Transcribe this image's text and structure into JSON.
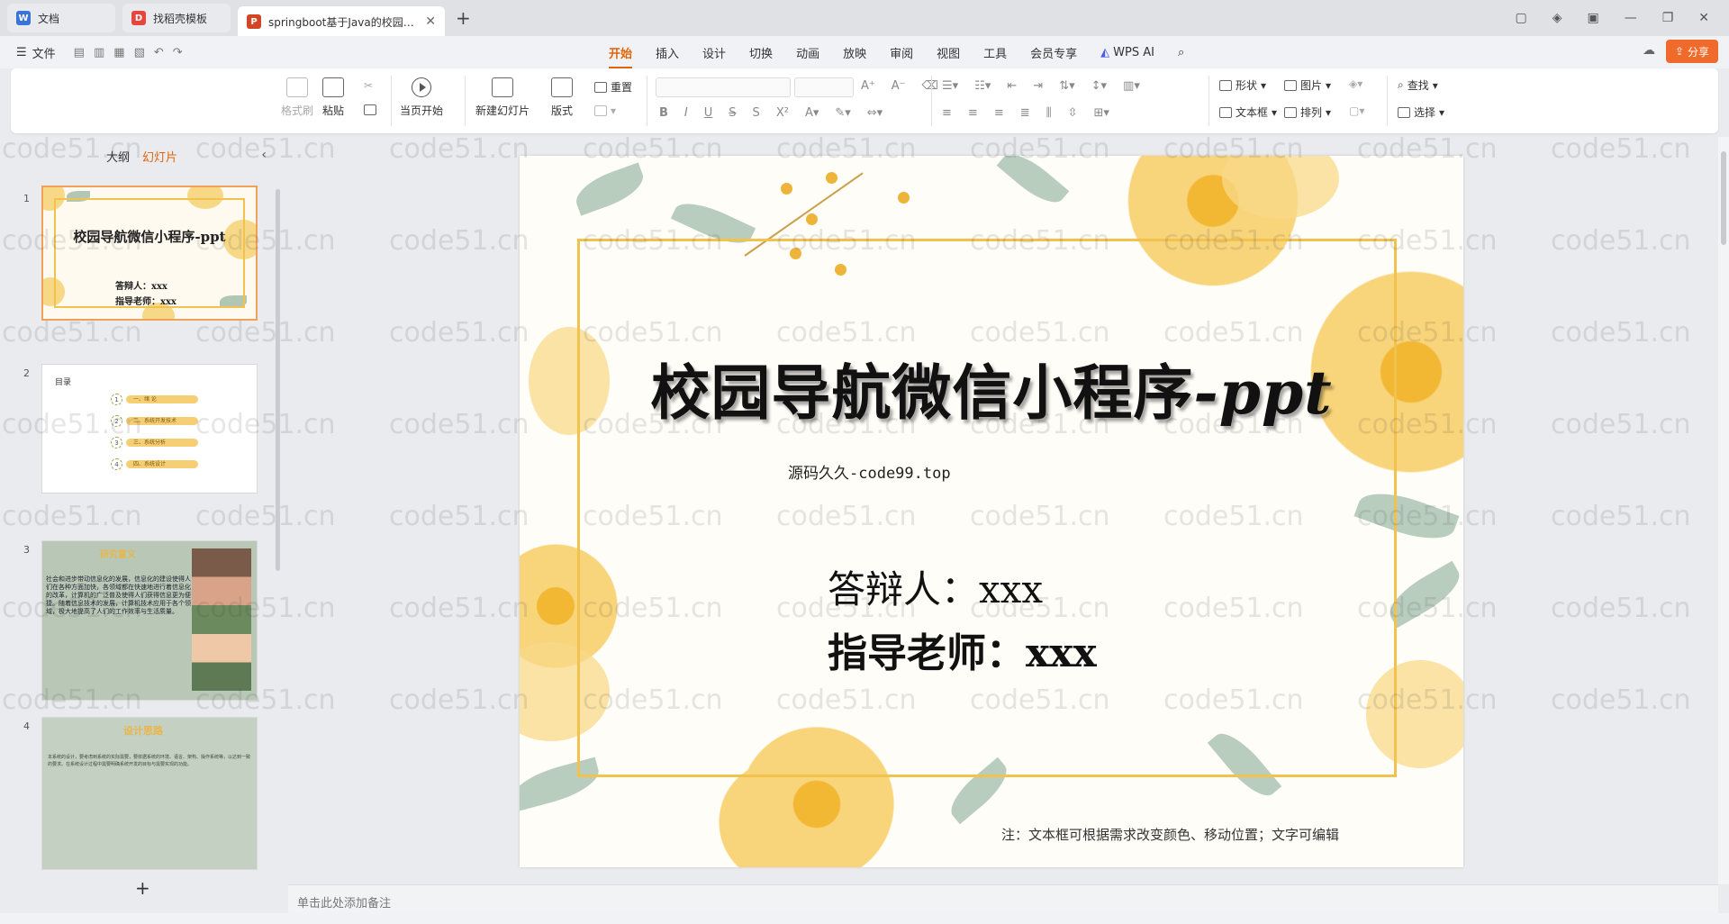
{
  "tabs": [
    {
      "label": "文档",
      "icon": "doc-icon",
      "color": "#3a74d8"
    },
    {
      "label": "找稻壳模板",
      "icon": "docer-icon",
      "color": "#e8453c"
    },
    {
      "label": "springboot基于Java的校园导航",
      "icon": "ppt-icon",
      "color": "#d24625"
    }
  ],
  "menu": {
    "file": "文件",
    "tabs": [
      "开始",
      "插入",
      "设计",
      "切换",
      "动画",
      "放映",
      "审阅",
      "视图",
      "工具",
      "会员专享"
    ],
    "active_tab": "开始",
    "wps_ai": "WPS AI",
    "share": "分享"
  },
  "ribbon": {
    "format_painter": "格式刷",
    "paste": "粘贴",
    "from_start": "当页开始",
    "new_slide": "新建幻灯片",
    "layout": "版式",
    "reset": "重置",
    "shapes": "形状",
    "picture": "图片",
    "textbox": "文本框",
    "arrange": "排列",
    "find": "查找",
    "select": "选择"
  },
  "panel": {
    "tab_outline": "大纲",
    "tab_slides": "幻灯片",
    "slides": [
      {
        "num": "1",
        "title": "校园导航微信小程序-ppt",
        "lines": [
          "答辩人：xxx",
          "指导老师：xxx"
        ]
      },
      {
        "num": "2",
        "label": "目录",
        "items": [
          "一、绪 论",
          "二、系统开发技术",
          "三、系统分析",
          "四、系统设计"
        ]
      },
      {
        "num": "3",
        "header": "研究意义",
        "body": "社会和进步带动信息化的发展，信息化的建设使得人们在各种方面加快，各领域都在快速地进行着信息化的改革，计算机的广泛普及使得人们获得信息更为便捷。随着信息技术的发展，计算机技术应用于各个领域，极大地提高了人们的工作效率与生活质量。"
      },
      {
        "num": "4",
        "header": "设计思路",
        "body": "本系统的设计，要考虑到系统的实际需要，要依据系统的环境、语言、架构、操作系统等，以达到一致的要求。在系统设计过程中需要明确系统开发的目标与需要实现的功能。"
      }
    ],
    "add": "+"
  },
  "slide": {
    "title_cn": "校园导航微信小程序",
    "title_en": "-ppt",
    "subtitle": "源码久久-code99.top",
    "line1": "答辩人：xxx",
    "line2": "指导老师：xxx",
    "note": "注：文本框可根据需求改变颜色、移动位置；文字可编辑"
  },
  "notes_placeholder": "单击此处添加备注",
  "watermark": "code51.cn",
  "colors": {
    "accent": "#e0650a",
    "share": "#f06a2b",
    "frame": "#f2c24f"
  }
}
